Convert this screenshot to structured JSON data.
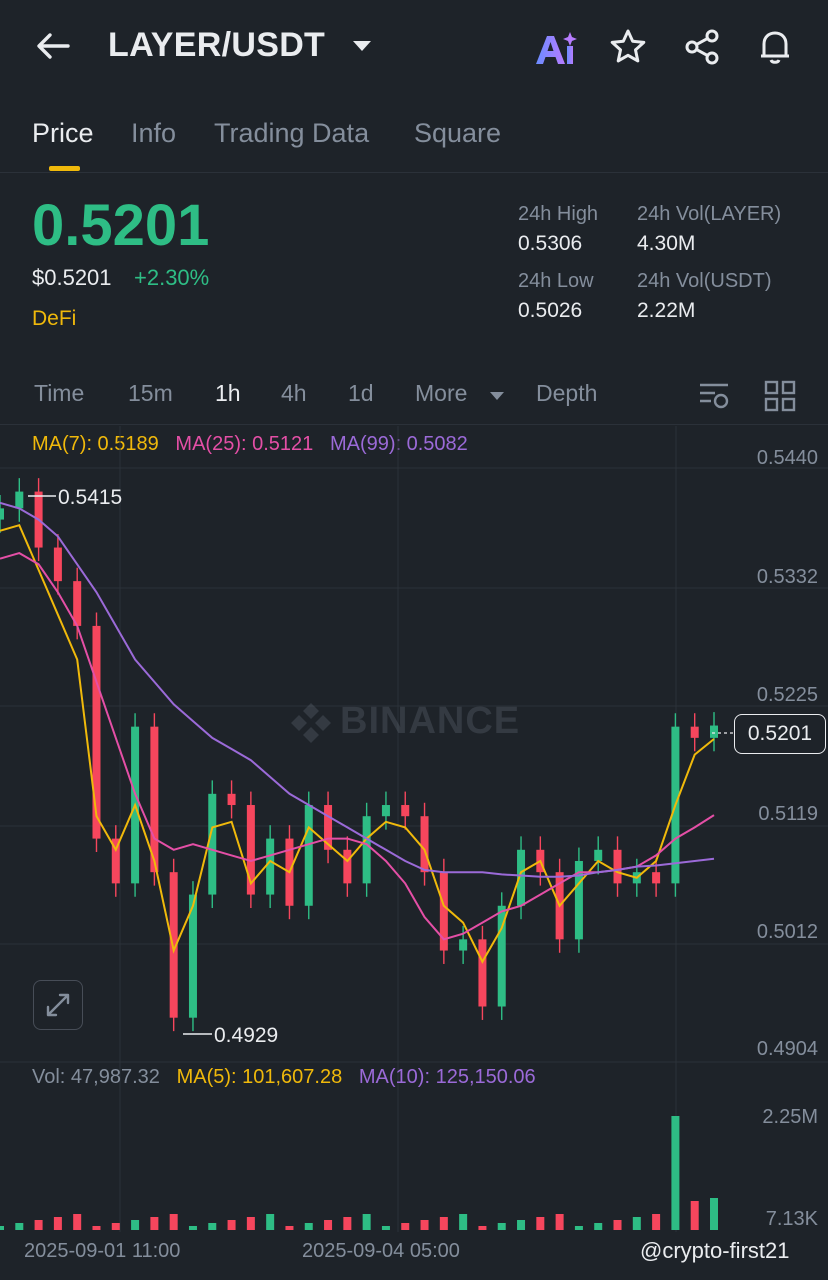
{
  "header": {
    "title": "LAYER/USDT",
    "icons": [
      "back-arrow-icon",
      "chevron-down-icon",
      "ai-icon",
      "star-icon",
      "share-icon",
      "bell-icon"
    ]
  },
  "tabs": [
    {
      "label": "Price",
      "active": true
    },
    {
      "label": "Info"
    },
    {
      "label": "Trading Data"
    },
    {
      "label": "Square"
    }
  ],
  "ticker": {
    "last_price": "0.5201",
    "usd_price": "$0.5201",
    "change_pct": "+2.30%",
    "tag": "DeFi",
    "high_label": "24h High",
    "high": "0.5306",
    "low_label": "24h Low",
    "low": "0.5026",
    "vol_base_label": "24h Vol(LAYER)",
    "vol_base": "4.30M",
    "vol_quote_label": "24h Vol(USDT)",
    "vol_quote": "2.22M",
    "up_color": "#2ebd85",
    "down_color": "#f6465d"
  },
  "intervals": [
    {
      "label": "Time"
    },
    {
      "label": "15m"
    },
    {
      "label": "1h",
      "active": true
    },
    {
      "label": "4h"
    },
    {
      "label": "1d"
    },
    {
      "label": "More"
    },
    {
      "label": "Depth"
    }
  ],
  "indicators": {
    "ma7": "MA(7): 0.5189",
    "ma25": "MA(25): 0.5121",
    "ma99": "MA(99): 0.5082",
    "vol": "Vol: 47,987.32",
    "vol_ma5": "MA(5): 101,607.28",
    "vol_ma10": "MA(10): 125,150.06"
  },
  "chart": {
    "y_ticks": [
      "0.5440",
      "0.5332",
      "0.5225",
      "0.5119",
      "0.5012",
      "0.4904"
    ],
    "vol_ticks": [
      "2.25M",
      "7.13K"
    ],
    "x_ticks": [
      "2025-09-01 11:00",
      "2025-09-04 05:00"
    ],
    "current_price": "0.5201",
    "marked_high": "0.5415",
    "marked_low": "0.4929",
    "watermark": "BINANCE",
    "credit": "@crypto-first21"
  },
  "chart_data": {
    "type": "line",
    "ylim": [
      0.4904,
      0.544
    ],
    "series": [
      {
        "name": "MA(7)",
        "color": "#f0b90b",
        "values": [
          0.5375,
          0.538,
          0.534,
          0.53,
          0.526,
          0.512,
          0.509,
          0.513,
          0.508,
          0.5,
          0.504,
          0.511,
          0.5115,
          0.506,
          0.508,
          0.507,
          0.511,
          0.5095,
          0.508,
          0.51,
          0.5115,
          0.511,
          0.509,
          0.504,
          0.5025,
          0.499,
          0.502,
          0.507,
          0.508,
          0.504,
          0.506,
          0.508,
          0.507,
          0.5065,
          0.508,
          0.513,
          0.5175,
          0.5189
        ]
      },
      {
        "name": "MA(25)",
        "color": "#e44fa6",
        "values": [
          0.535,
          0.5355,
          0.5345,
          0.532,
          0.529,
          0.524,
          0.519,
          0.514,
          0.51,
          0.509,
          0.5095,
          0.509,
          0.5085,
          0.508,
          0.5085,
          0.509,
          0.5095,
          0.51,
          0.51,
          0.5095,
          0.508,
          0.506,
          0.503,
          0.501,
          0.5015,
          0.5025,
          0.5035,
          0.504,
          0.505,
          0.506,
          0.507,
          0.507,
          0.5072,
          0.5075,
          0.5085,
          0.51,
          0.511,
          0.5121
        ]
      },
      {
        "name": "MA(99)",
        "color": "#9b6ad8",
        "values": [
          0.54,
          0.5395,
          0.5385,
          0.537,
          0.5345,
          0.532,
          0.529,
          0.526,
          0.524,
          0.522,
          0.5205,
          0.519,
          0.518,
          0.517,
          0.5155,
          0.514,
          0.513,
          0.512,
          0.511,
          0.51,
          0.509,
          0.508,
          0.5072,
          0.507,
          0.507,
          0.507,
          0.5068,
          0.5067,
          0.5066,
          0.5066,
          0.5067,
          0.507,
          0.5072,
          0.5075,
          0.5076,
          0.5078,
          0.508,
          0.5082
        ]
      }
    ],
    "candles_close": [
      0.5395,
      0.541,
      0.536,
      0.533,
      0.529,
      0.51,
      0.506,
      0.52,
      0.507,
      0.494,
      0.505,
      0.514,
      0.513,
      0.505,
      0.51,
      0.504,
      0.513,
      0.509,
      0.506,
      0.512,
      0.513,
      0.512,
      0.507,
      0.5,
      0.501,
      0.495,
      0.504,
      0.509,
      0.507,
      0.501,
      0.508,
      0.509,
      0.506,
      0.507,
      0.506,
      0.52,
      0.519,
      0.5201
    ],
    "volume": {
      "ticks": [
        "2.25M",
        "7.13K"
      ],
      "current": "47,987.32"
    }
  }
}
